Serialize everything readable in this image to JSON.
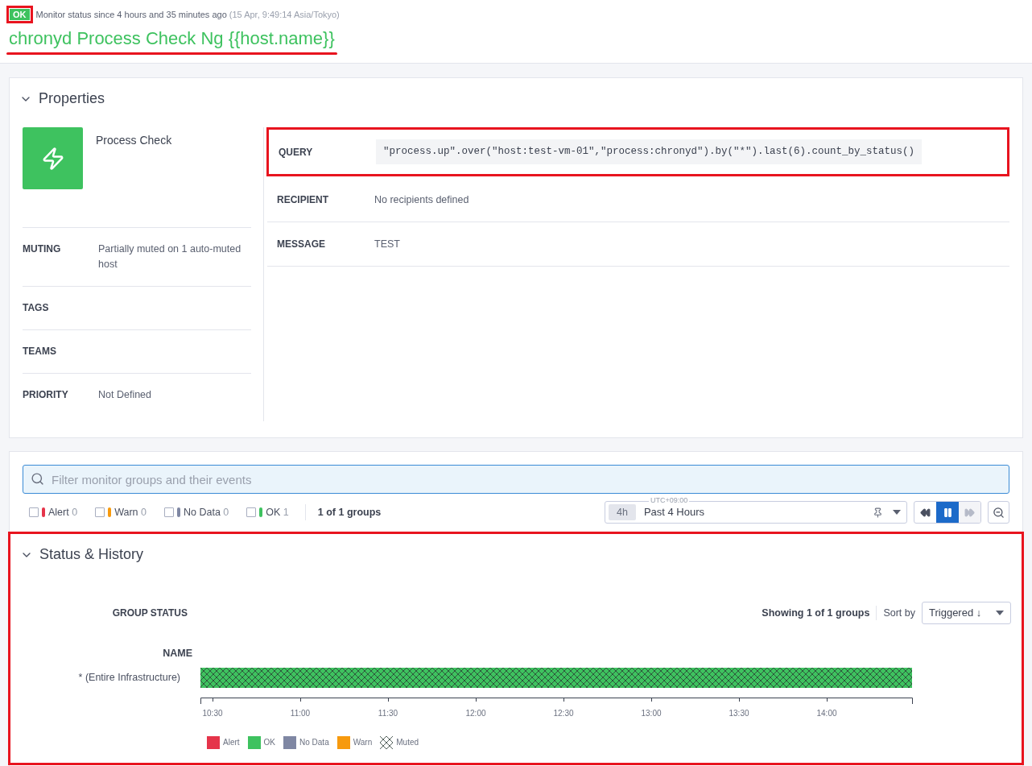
{
  "status": {
    "badge": "OK",
    "color": "#3ec25f",
    "text": "Monitor status since 4 hours and 35 minutes ago",
    "timestamp": "(15 Apr, 9:49:14 Asia/Tokyo)"
  },
  "title": "chronyd Process Check Ng {{host.name}}",
  "properties": {
    "heading": "Properties",
    "expanded": true,
    "monitor_type": "Process Check",
    "left_rows": [
      {
        "label": "MUTING",
        "value": "Partially muted on 1 auto-muted host"
      },
      {
        "label": "TAGS"
      },
      {
        "label": "TEAMS"
      },
      {
        "label": "PRIORITY",
        "value": "Not Defined"
      }
    ],
    "right_rows": [
      {
        "label": "QUERY",
        "value": "\"process.up\".over(\"host:test-vm-01\",\"process:chronyd\").by(\"*\").last(6).count_by_status()",
        "kind": "code"
      },
      {
        "label": "RECIPIENT",
        "value": "No recipients defined",
        "kind": "text"
      },
      {
        "label": "MESSAGE",
        "value": "TEST",
        "kind": "text"
      }
    ]
  },
  "filter": {
    "placeholder": "Filter monitor groups and their events",
    "statuses": [
      {
        "label": "Alert",
        "count": "0",
        "color": "#e5344a",
        "checked": false
      },
      {
        "label": "Warn",
        "count": "0",
        "color": "#f79a0e",
        "checked": false
      },
      {
        "label": "No Data",
        "count": "0",
        "color": "#7f87a3",
        "checked": false
      },
      {
        "label": "OK",
        "count": "1",
        "color": "#3ec25f",
        "checked": false
      }
    ],
    "group_count": "1 of 1 groups",
    "timeframe": {
      "timezone": "UTC+09:00",
      "badge": "4h",
      "label": "Past 4 Hours"
    },
    "paused": true
  },
  "status_history": {
    "heading": "Status & History",
    "expanded": true,
    "group_status_label": "GROUP STATUS",
    "showing": "Showing 1 of 1 groups",
    "sort_label": "Sort by",
    "sort_value": "Triggered ↓",
    "name_label": "NAME",
    "groups": [
      {
        "name": "* (Entire Infrastructure)",
        "color": "#3ec25f",
        "muted": true
      }
    ],
    "ticks": [
      "10:30",
      "11:00",
      "11:30",
      "12:00",
      "12:30",
      "13:00",
      "13:30",
      "14:00"
    ],
    "legend": [
      {
        "label": "Alert",
        "kind": "color",
        "color": "#e5344a"
      },
      {
        "label": "OK",
        "kind": "color",
        "color": "#3ec25f"
      },
      {
        "label": "No Data",
        "kind": "color",
        "color": "#7f87a3"
      },
      {
        "label": "Warn",
        "kind": "color",
        "color": "#f79a0e"
      },
      {
        "label": "Muted",
        "kind": "pattern"
      }
    ]
  }
}
